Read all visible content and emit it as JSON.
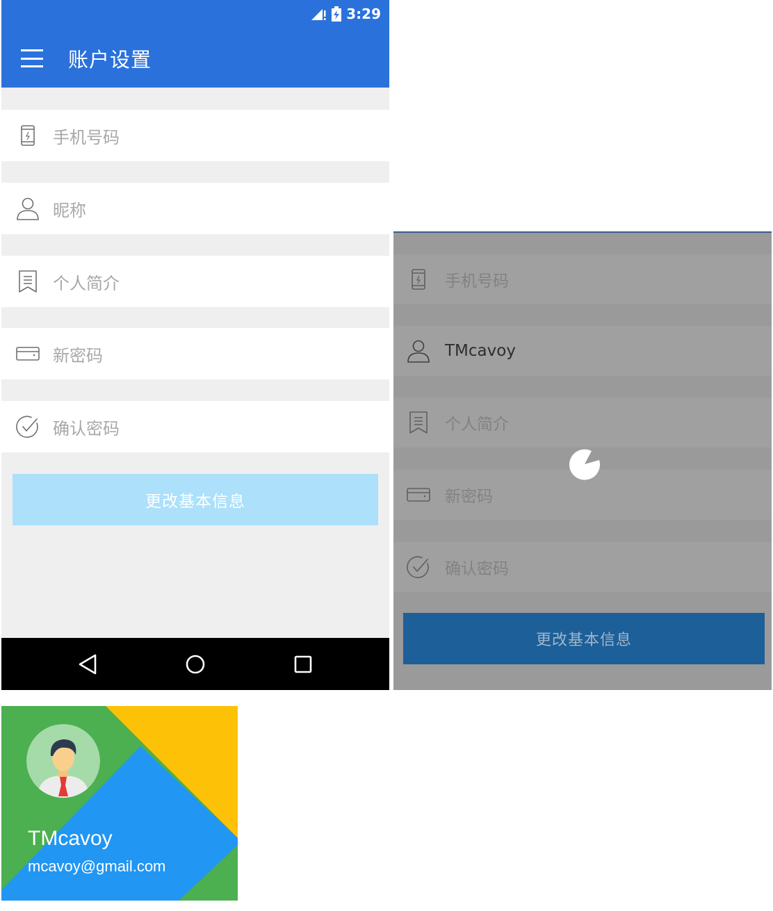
{
  "status_bar": {
    "time": "3:29"
  },
  "app_bar": {
    "title": "账户设置"
  },
  "form": {
    "phone_placeholder": "手机号码",
    "nickname_placeholder": "昵称",
    "bio_placeholder": "个人简介",
    "new_password_placeholder": "新密码",
    "confirm_password_placeholder": "确认密码",
    "submit_label": "更改基本信息"
  },
  "loading_screen": {
    "phone_placeholder": "手机号码",
    "nickname_value": "TMcavoy",
    "bio_placeholder": "个人简介",
    "new_password_placeholder": "新密码",
    "confirm_password_placeholder": "确认密码",
    "submit_label": "更改基本信息"
  },
  "drawer_header": {
    "user_name": "TMcavoy",
    "user_email": "mcavoy@gmail.com"
  },
  "colors": {
    "primary": "#2a71dc",
    "button_disabled": "#ace0fb",
    "button_active": "#1d5f98",
    "drawer_green": "#4caf50",
    "drawer_blue": "#2196f3",
    "drawer_yellow": "#fdc107"
  }
}
